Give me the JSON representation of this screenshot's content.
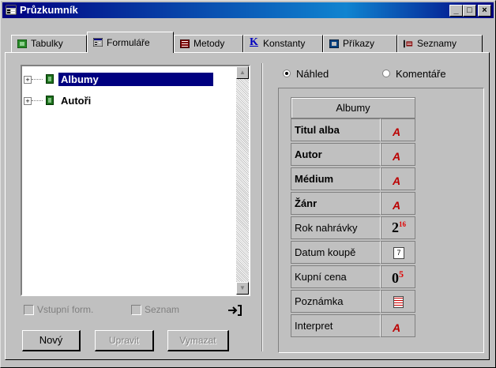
{
  "window": {
    "title": "Průzkumník",
    "controls": [
      "minimize",
      "maximize",
      "close"
    ]
  },
  "tabs": [
    {
      "label": "Tabulky",
      "icon": "table-icon"
    },
    {
      "label": "Formuláře",
      "icon": "form-icon",
      "active": true
    },
    {
      "label": "Metody",
      "icon": "method-icon"
    },
    {
      "label": "Konstanty",
      "icon": "constant-k-icon"
    },
    {
      "label": "Příkazy",
      "icon": "command-icon"
    },
    {
      "label": "Seznamy",
      "icon": "list-icon"
    }
  ],
  "tree": {
    "items": [
      {
        "label": "Albumy",
        "selected": true
      },
      {
        "label": "Autoři",
        "selected": false
      }
    ]
  },
  "options": {
    "input_form": "Vstupní form.",
    "list": "Seznam"
  },
  "buttons": {
    "new": "Nový",
    "edit": "Upravit",
    "delete": "Vymazat"
  },
  "view_mode": {
    "preview": "Náhled",
    "comments": "Komentáře",
    "selected": "preview"
  },
  "form_preview": {
    "title": "Albumy",
    "fields": [
      {
        "label": "Titul alba",
        "bold": true,
        "type": "text-icon"
      },
      {
        "label": "Autor",
        "bold": true,
        "type": "text-icon"
      },
      {
        "label": "Médium",
        "bold": true,
        "type": "text-icon"
      },
      {
        "label": "Žánr",
        "bold": true,
        "type": "text-icon"
      },
      {
        "label": "Rok nahrávky",
        "bold": false,
        "type": "integer-icon",
        "sym": "2",
        "sup": "16"
      },
      {
        "label": "Datum koupě",
        "bold": false,
        "type": "date-icon",
        "sym": "7"
      },
      {
        "label": "Kupní cena",
        "bold": false,
        "type": "real-icon",
        "sym": "0",
        "sup": "5"
      },
      {
        "label": "Poznámka",
        "bold": false,
        "type": "memo-icon"
      },
      {
        "label": "Interpret",
        "bold": false,
        "type": "text-icon"
      }
    ]
  },
  "text_icon_glyph": "A"
}
